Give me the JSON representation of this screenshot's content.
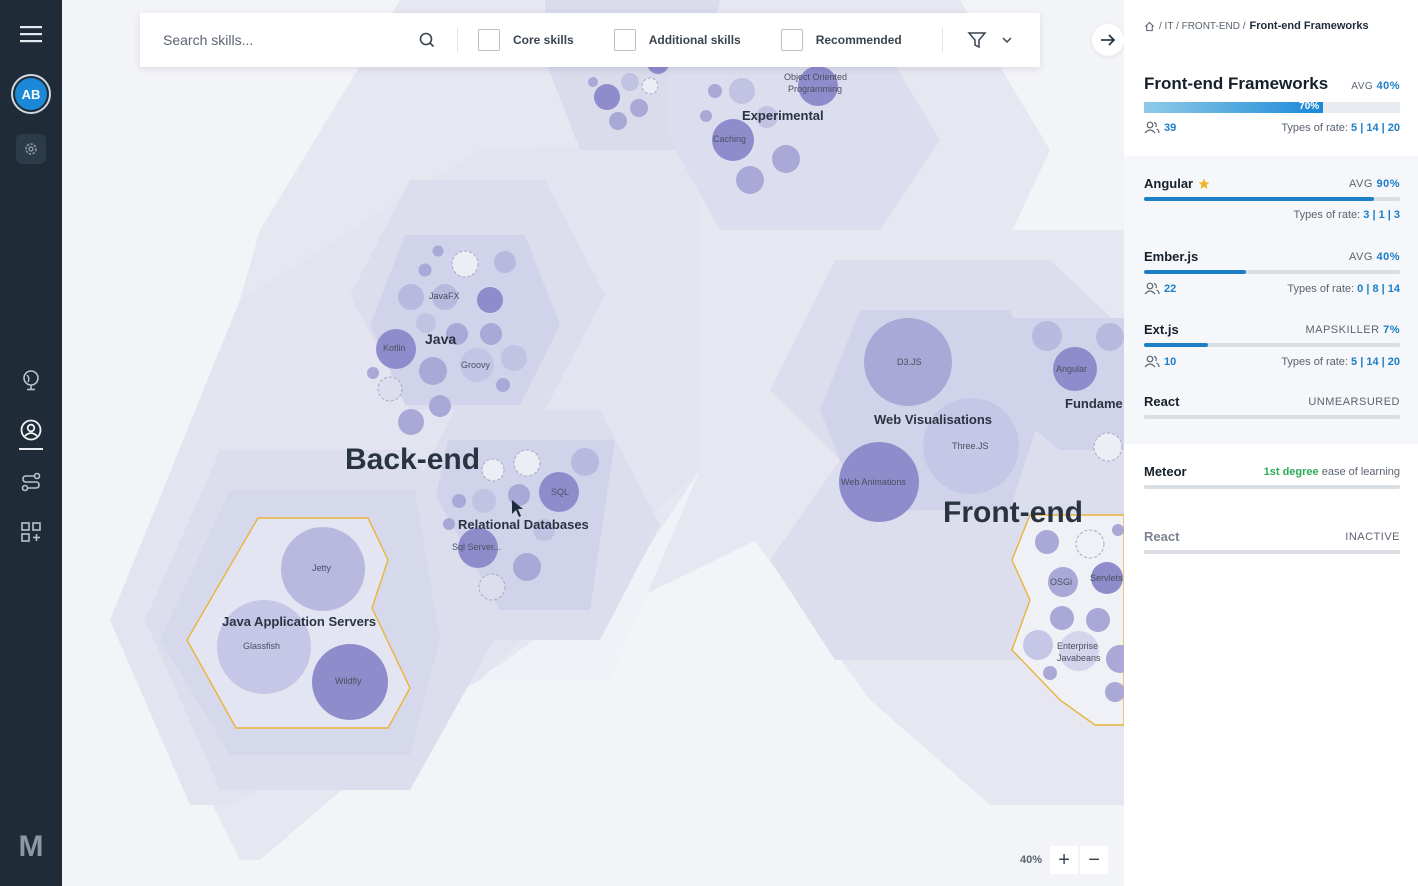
{
  "nav": {
    "avatar_initials": "AB",
    "logo": "M",
    "icons": [
      "menu-icon",
      "gear-icon",
      "globe-icon",
      "user-circle-icon",
      "route-icon",
      "dashboard-add-icon"
    ]
  },
  "toolbar": {
    "search_placeholder": "Search skills...",
    "filters": [
      {
        "label": "Core skills"
      },
      {
        "label": "Additional skills"
      },
      {
        "label": "Recommended"
      }
    ]
  },
  "map": {
    "areas": [
      {
        "label": "Back-end"
      },
      {
        "label": "Front-end"
      }
    ],
    "clusters": [
      {
        "label": "Java"
      },
      {
        "label": "Relational Databases"
      },
      {
        "label": "Java Application Servers"
      },
      {
        "label": "Experimental"
      },
      {
        "label": "Web Visualisations"
      },
      {
        "label": "Fundame"
      }
    ],
    "skills": {
      "javafx": "JavaFX",
      "kotlin": "Kotlin",
      "groovy": "Groovy",
      "sql": "SQL",
      "sqlserver": "Sql Server...",
      "jetty": "Jetty",
      "glassfish": "Glassfish",
      "wildfly": "Wildfly",
      "caching": "Caching",
      "oop": "Object Oriented",
      "oop2": "Programming",
      "d3": "D3.JS",
      "three": "Three.JS",
      "webanim": "Web Animations",
      "angular": "Angular",
      "osgi": "OSGi",
      "servlets": "Servlets",
      "ejb1": "Enterprise",
      "ejb2": "Javabeans"
    }
  },
  "zoom": {
    "level": "40%",
    "plus": "+",
    "minus": "−"
  },
  "panel": {
    "breadcrumb": {
      "sep1": "/ IT / FRONT-END /",
      "current": "Front-end Frameworks"
    },
    "title": "Front-end Frameworks",
    "avg_label": "AVG",
    "avg_value": "40%",
    "progress": 0.7,
    "progress_label": "70%",
    "users": "39",
    "rates_label": "Types of rate:",
    "rates": "5 | 14 | 20",
    "items": [
      {
        "name": "Angular",
        "status_label": "AVG",
        "status_value": "90%",
        "progress": 0.9,
        "rates": "3 | 1 | 3"
      },
      {
        "name": "Ember.js",
        "status_label": "AVG",
        "status_value": "40%",
        "progress": 0.4,
        "users": "22",
        "rates": "0 | 8 | 14"
      },
      {
        "name": "Ext.js",
        "status_label": "MAPSKILLER",
        "status_value": "7%",
        "progress": 0.25,
        "users": "10",
        "rates": "5 | 14 | 20"
      },
      {
        "name": "React",
        "status_label": "UNMEARSURED"
      }
    ],
    "meteor": {
      "name": "Meteor",
      "degree": "1st degree",
      "text": "ease of learning"
    },
    "react_inactive": {
      "name": "React",
      "status": "INACTIVE"
    }
  }
}
